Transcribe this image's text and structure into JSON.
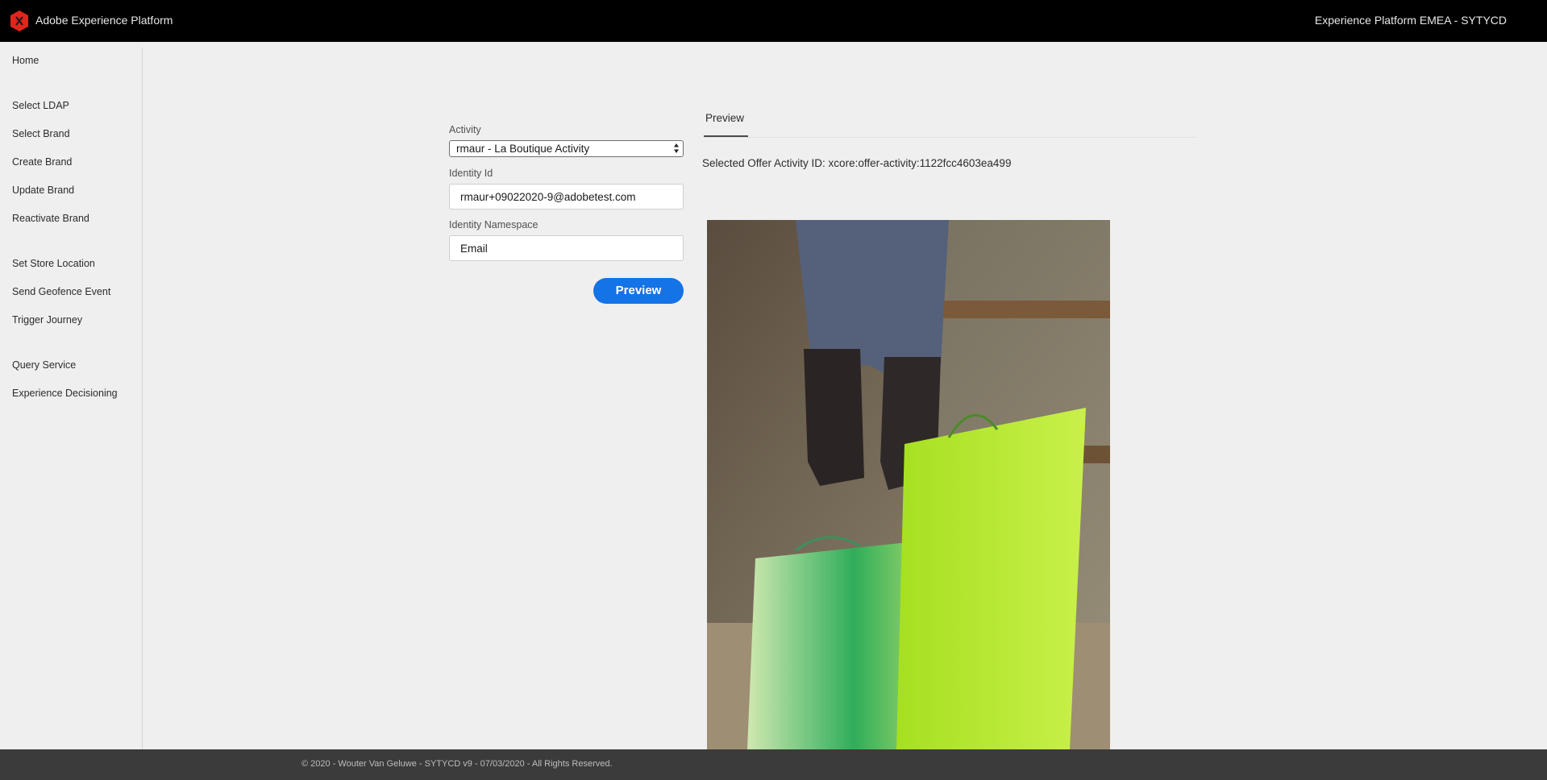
{
  "header": {
    "app_title": "Adobe Experience Platform",
    "org_title": "Experience Platform EMEA - SYTYCD",
    "brand_color": "#fa0f00"
  },
  "sidebar": {
    "items": [
      {
        "label": "Home"
      },
      {
        "label": "Select LDAP"
      },
      {
        "label": "Select Brand"
      },
      {
        "label": "Create Brand"
      },
      {
        "label": "Update Brand"
      },
      {
        "label": "Reactivate Brand"
      },
      {
        "label": "Set Store Location"
      },
      {
        "label": "Send Geofence Event"
      },
      {
        "label": "Trigger Journey"
      },
      {
        "label": "Query Service"
      },
      {
        "label": "Experience Decisioning"
      }
    ]
  },
  "form": {
    "activity_label": "Activity",
    "activity_value": "rmaur - La Boutique Activity",
    "identity_id_label": "Identity Id",
    "identity_id_value": "rmaur+09022020-9@adobetest.com",
    "identity_namespace_label": "Identity Namespace",
    "identity_namespace_value": "Email",
    "preview_button_label": "Preview"
  },
  "preview": {
    "tab_label": "Preview",
    "selected_offer_text": "Selected Offer Activity ID: xcore:offer-activity:1122fcc4603ea499",
    "image_icon": "offer-image"
  },
  "footer": {
    "text": "© 2020 - Wouter Van Geluwe - SYTYCD v9 - 07/03/2020 - All Rights Reserved."
  }
}
